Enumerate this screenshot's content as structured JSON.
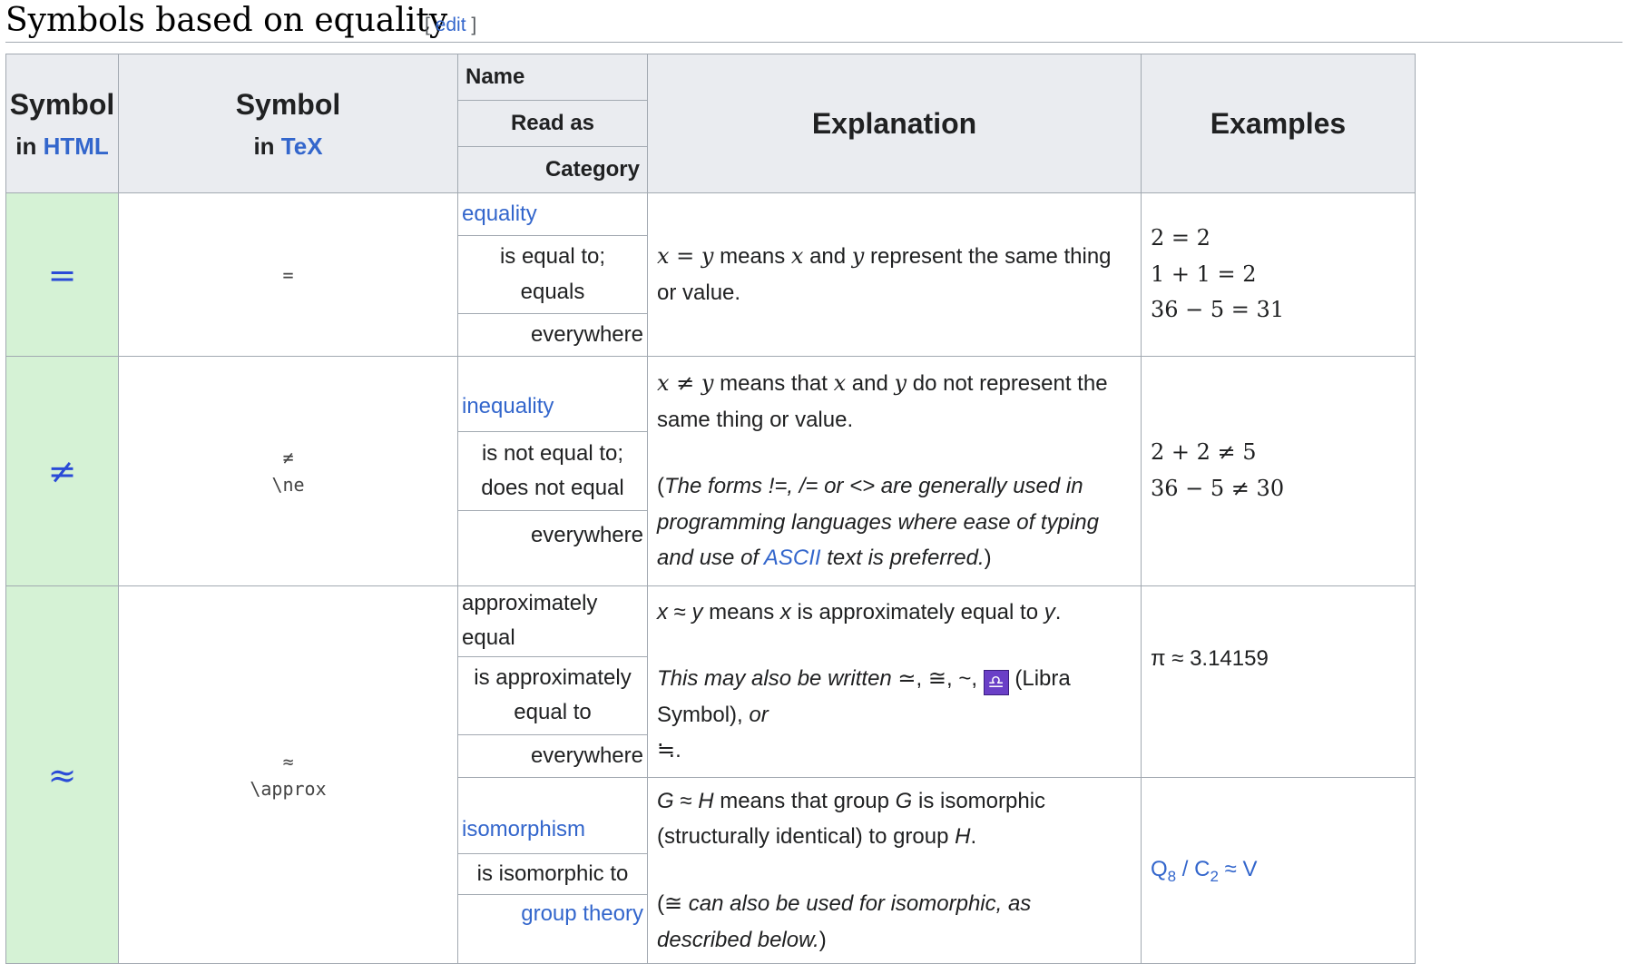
{
  "section": {
    "title": "Symbols based on equality",
    "edit_label": "edit"
  },
  "header": {
    "symbol_html_line1": "Symbol",
    "symbol_html_in": "in ",
    "symbol_html_link": "HTML",
    "symbol_tex_line1": "Symbol",
    "symbol_tex_in": "in ",
    "symbol_tex_link": "TeX",
    "name": "Name",
    "read_as": "Read as",
    "category": "Category",
    "explanation": "Explanation",
    "examples": "Examples"
  },
  "rows": [
    {
      "html_symbol": "=",
      "tex_symbol": "=",
      "name": "equality",
      "read_as_1": "is equal to;",
      "read_as_2": "equals",
      "category": "everywhere",
      "explanation_vars": {
        "a": "x",
        "op": " = ",
        "b": "y"
      },
      "explanation_text_1": " means ",
      "explanation_text_2": " and ",
      "explanation_text_3": " represent the same thing or value.",
      "examples": [
        "2 = 2",
        "1 + 1 = 2",
        "36 − 5 = 31"
      ]
    },
    {
      "html_symbol": "≠",
      "tex_symbol": "≠",
      "tex_command": "\\ne",
      "name": "inequality",
      "read_as_1": "is not equal to;",
      "read_as_2": "does not equal",
      "category": "everywhere",
      "explanation_vars": {
        "a": "x",
        "op": " ≠ ",
        "b": "y"
      },
      "explanation_text_1": " means that ",
      "explanation_text_2": " and ",
      "explanation_text_3": " do not represent the same thing or value.",
      "note_pre": "(",
      "note_italic_1": "The forms !=, /= or <> are generally used in programming languages where ease of typing and use of ",
      "note_link": "ASCII",
      "note_italic_2": " text is preferred.",
      "note_post": ")",
      "examples": [
        "2 + 2 ≠ 5",
        "36 − 5 ≠ 30"
      ]
    },
    {
      "html_symbol": "≈",
      "tex_symbol": "≈",
      "tex_command": "\\approx",
      "name": "approximately equal",
      "read_as_1": "is approximately",
      "read_as_2": "equal to",
      "category": "everywhere",
      "explanation_vars": {
        "a": "x",
        "op": " ≈ ",
        "b": "y"
      },
      "explanation_text_1": " means ",
      "explanation_text_2": " is approximately equal to ",
      "explanation_text_3": ".",
      "note_italic_1": "This may also be written",
      "note_symbols": " ≃, ≅, ~, ",
      "libra_icon": "♎",
      "note_libra": " (Libra Symbol), ",
      "note_or": "or",
      "note_last": "≒.",
      "examples": [
        "π ≈ 3.14159"
      ]
    },
    {
      "name": "isomorphism",
      "read_as_1": "is isomorphic to",
      "category": "group theory",
      "explanation_a": "G",
      "explanation_op": " ≈ ",
      "explanation_b": "H",
      "explanation_text_1": " means that group ",
      "explanation_c": "G",
      "explanation_text_2": " is isomorphic (structurally identical) to group ",
      "explanation_d": "H",
      "explanation_text_3": ".",
      "note_pre": "(",
      "note_symbol": "≅",
      "note_italic": " can also be used for isomorphic, as described below.",
      "note_post": ")",
      "example_q": "Q",
      "example_q_sub": "8",
      "example_sep": " / ",
      "example_c": "C",
      "example_c_sub": "2",
      "example_tail": " ≈ V"
    }
  ]
}
